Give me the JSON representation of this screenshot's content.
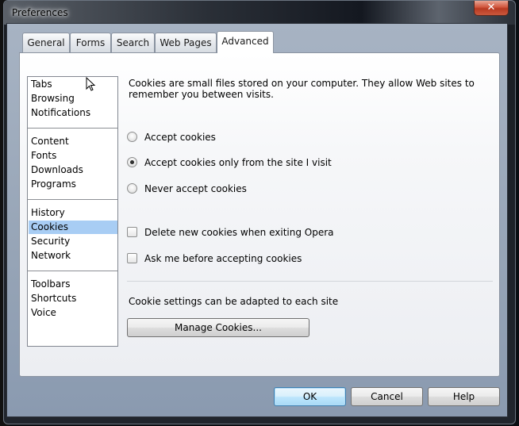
{
  "window": {
    "title": "Preferences",
    "close_glyph": "✕"
  },
  "tabs": [
    {
      "label": "General",
      "active": false
    },
    {
      "label": "Forms",
      "active": false
    },
    {
      "label": "Search",
      "active": false
    },
    {
      "label": "Web Pages",
      "active": false
    },
    {
      "label": "Advanced",
      "active": true
    }
  ],
  "sidebar": {
    "groups": [
      [
        "Tabs",
        "Browsing",
        "Notifications"
      ],
      [
        "Content",
        "Fonts",
        "Downloads",
        "Programs"
      ],
      [
        "History",
        "Cookies",
        "Security",
        "Network"
      ],
      [
        "Toolbars",
        "Shortcuts",
        "Voice"
      ]
    ],
    "selected": "Cookies"
  },
  "cookies": {
    "description": "Cookies are small files stored on your computer. They allow Web sites to remember you between visits.",
    "radio_options": [
      {
        "label": "Accept cookies",
        "checked": false
      },
      {
        "label": "Accept cookies only from the site I visit",
        "checked": true
      },
      {
        "label": "Never accept cookies",
        "checked": false
      }
    ],
    "checkboxes": [
      {
        "label": "Delete new cookies when exiting Opera",
        "checked": false
      },
      {
        "label": "Ask me before accepting cookies",
        "checked": false
      }
    ],
    "site_note": "Cookie settings can be adapted to each site",
    "manage_button": "Manage Cookies..."
  },
  "footer": {
    "ok": "OK",
    "cancel": "Cancel",
    "help": "Help"
  }
}
